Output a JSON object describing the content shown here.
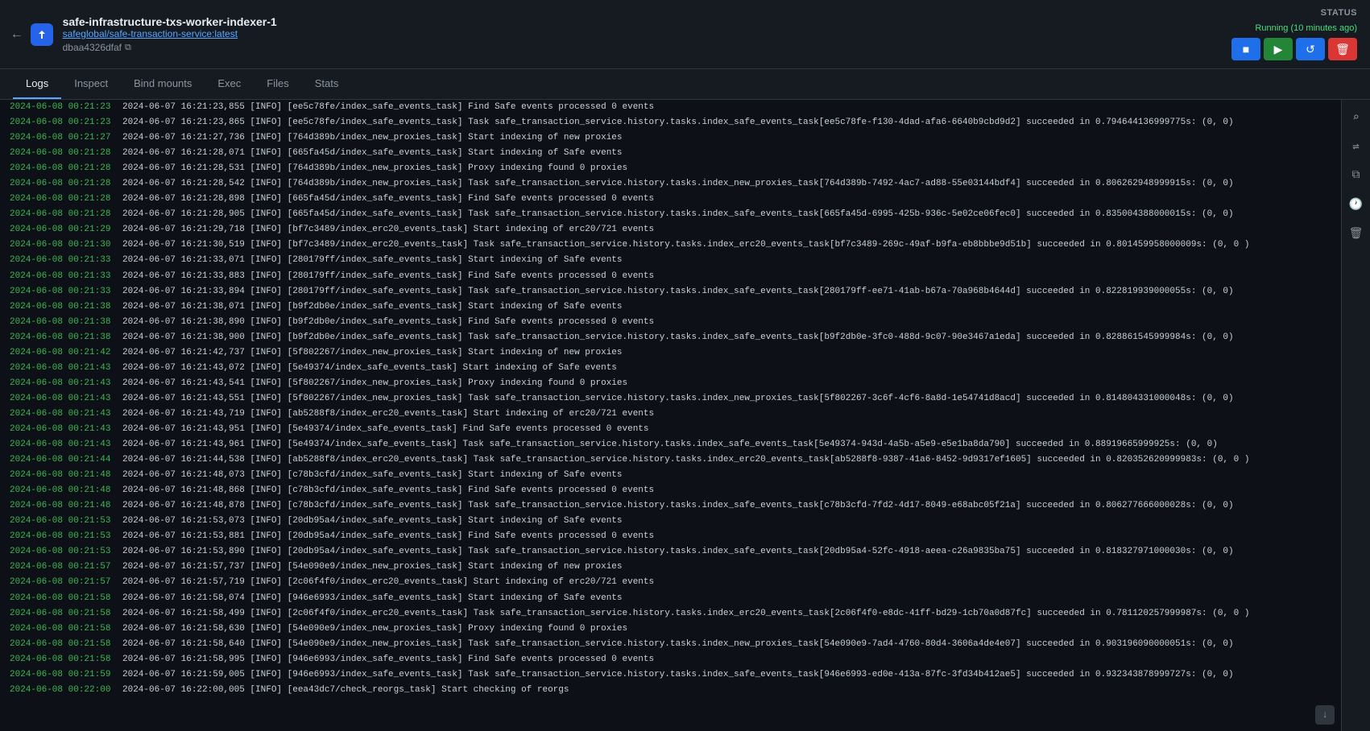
{
  "header": {
    "title": "safe-infrastructure-txs-worker-indexer-1",
    "subtitle": "safeglobal/safe-transaction-service:latest",
    "hash": "dbaa4326dfaf",
    "back_label": "←",
    "icon_text": "S",
    "copy_icon": "⧉"
  },
  "status": {
    "label": "STATUS",
    "text": "Running (10 minutes ago)",
    "buttons": {
      "stop_label": "■",
      "play_label": "▶",
      "restart_label": "↺",
      "delete_label": "🗑"
    }
  },
  "tabs": [
    {
      "id": "logs",
      "label": "Logs",
      "active": true
    },
    {
      "id": "inspect",
      "label": "Inspect",
      "active": false
    },
    {
      "id": "bind-mounts",
      "label": "Bind mounts",
      "active": false
    },
    {
      "id": "exec",
      "label": "Exec",
      "active": false
    },
    {
      "id": "files",
      "label": "Files",
      "active": false
    },
    {
      "id": "stats",
      "label": "Stats",
      "active": false
    }
  ],
  "sidebar_icons": [
    {
      "name": "search-icon",
      "symbol": "⌕"
    },
    {
      "name": "wrap-icon",
      "symbol": "⇌"
    },
    {
      "name": "copy-log-icon",
      "symbol": "⧉"
    },
    {
      "name": "clock-icon",
      "symbol": "🕐"
    },
    {
      "name": "trash-icon",
      "symbol": "🗑"
    }
  ],
  "logs": [
    {
      "ts": "2024-06-08 00:21:23",
      "line": "2024-06-07 16:21:23,855 [INFO] [ee5c78fe/index_safe_events_task] Find Safe events processed 0 events"
    },
    {
      "ts": "2024-06-08 00:21:23",
      "line": "2024-06-07 16:21:23,865 [INFO] [ee5c78fe/index_safe_events_task] Task safe_transaction_service.history.tasks.index_safe_events_task[ee5c78fe-f130-4dad-afa6-6640b9cbd9d2] succeeded in 0.794644136999775s: (0, 0)"
    },
    {
      "ts": "2024-06-08 00:21:27",
      "line": "2024-06-07 16:21:27,736 [INFO] [764d389b/index_new_proxies_task] Start indexing of new proxies"
    },
    {
      "ts": "2024-06-08 00:21:28",
      "line": "2024-06-07 16:21:28,071 [INFO] [665fa45d/index_safe_events_task] Start indexing of Safe events"
    },
    {
      "ts": "2024-06-08 00:21:28",
      "line": "2024-06-07 16:21:28,531 [INFO] [764d389b/index_new_proxies_task] Proxy indexing found 0 proxies"
    },
    {
      "ts": "2024-06-08 00:21:28",
      "line": "2024-06-07 16:21:28,542 [INFO] [764d389b/index_new_proxies_task] Task safe_transaction_service.history.tasks.index_new_proxies_task[764d389b-7492-4ac7-ad88-55e03144bdf4] succeeded in 0.806262948999915s: (0, 0)"
    },
    {
      "ts": "2024-06-08 00:21:28",
      "line": "2024-06-07 16:21:28,898 [INFO] [665fa45d/index_safe_events_task] Find Safe events processed 0 events"
    },
    {
      "ts": "2024-06-08 00:21:28",
      "line": "2024-06-07 16:21:28,905 [INFO] [665fa45d/index_safe_events_task] Task safe_transaction_service.history.tasks.index_safe_events_task[665fa45d-6995-425b-936c-5e02ce06fec0] succeeded in 0.835004388000015s: (0, 0)"
    },
    {
      "ts": "2024-06-08 00:21:29",
      "line": "2024-06-07 16:21:29,718 [INFO] [bf7c3489/index_erc20_events_task] Start indexing of erc20/721 events"
    },
    {
      "ts": "2024-06-08 00:21:30",
      "line": "2024-06-07 16:21:30,519 [INFO] [bf7c3489/index_erc20_events_task] Task safe_transaction_service.history.tasks.index_erc20_events_task[bf7c3489-269c-49af-b9fa-eb8bbbe9d51b] succeeded in 0.801459958000009s: (0, 0\n)"
    },
    {
      "ts": "2024-06-08 00:21:33",
      "line": "2024-06-07 16:21:33,071 [INFO] [280179ff/index_safe_events_task] Start indexing of Safe events"
    },
    {
      "ts": "2024-06-08 00:21:33",
      "line": "2024-06-07 16:21:33,883 [INFO] [280179ff/index_safe_events_task] Find Safe events processed 0 events"
    },
    {
      "ts": "2024-06-08 00:21:33",
      "line": "2024-06-07 16:21:33,894 [INFO] [280179ff/index_safe_events_task] Task safe_transaction_service.history.tasks.index_safe_events_task[280179ff-ee71-41ab-b67a-70a968b4644d] succeeded in 0.822819939000055s: (0, 0)"
    },
    {
      "ts": "2024-06-08 00:21:38",
      "line": "2024-06-07 16:21:38,071 [INFO] [b9f2db0e/index_safe_events_task] Start indexing of Safe events"
    },
    {
      "ts": "2024-06-08 00:21:38",
      "line": "2024-06-07 16:21:38,890 [INFO] [b9f2db0e/index_safe_events_task] Find Safe events processed 0 events"
    },
    {
      "ts": "2024-06-08 00:21:38",
      "line": "2024-06-07 16:21:38,900 [INFO] [b9f2db0e/index_safe_events_task] Task safe_transaction_service.history.tasks.index_safe_events_task[b9f2db0e-3fc0-488d-9c07-90e3467a1eda] succeeded in 0.828861545999984s: (0, 0)"
    },
    {
      "ts": "2024-06-08 00:21:42",
      "line": "2024-06-07 16:21:42,737 [INFO] [5f802267/index_new_proxies_task] Start indexing of new proxies"
    },
    {
      "ts": "2024-06-08 00:21:43",
      "line": "2024-06-07 16:21:43,072 [INFO] [5e49374/index_safe_events_task] Start indexing of Safe events"
    },
    {
      "ts": "2024-06-08 00:21:43",
      "line": "2024-06-07 16:21:43,541 [INFO] [5f802267/index_new_proxies_task] Proxy indexing found 0 proxies"
    },
    {
      "ts": "2024-06-08 00:21:43",
      "line": "2024-06-07 16:21:43,551 [INFO] [5f802267/index_new_proxies_task] Task safe_transaction_service.history.tasks.index_new_proxies_task[5f802267-3c6f-4cf6-8a8d-1e54741d8acd] succeeded in 0.814804331000048s: (0, 0)"
    },
    {
      "ts": "2024-06-08 00:21:43",
      "line": "2024-06-07 16:21:43,719 [INFO] [ab5288f8/index_erc20_events_task] Start indexing of erc20/721 events"
    },
    {
      "ts": "2024-06-08 00:21:43",
      "line": "2024-06-07 16:21:43,951 [INFO] [5e49374/index_safe_events_task] Find Safe events processed 0 events"
    },
    {
      "ts": "2024-06-08 00:21:43",
      "line": "2024-06-07 16:21:43,961 [INFO] [5e49374/index_safe_events_task] Task safe_transaction_service.history.tasks.index_safe_events_task[5e49374-943d-4a5b-a5e9-e5e1ba8da790] succeeded in 0.88919665999925s: (0, 0)"
    },
    {
      "ts": "2024-06-08 00:21:44",
      "line": "2024-06-07 16:21:44,538 [INFO] [ab5288f8/index_erc20_events_task] Task safe_transaction_service.history.tasks.index_erc20_events_task[ab5288f8-9387-41a6-8452-9d9317ef1605] succeeded in 0.820352620999983s: (0, 0\n)"
    },
    {
      "ts": "2024-06-08 00:21:48",
      "line": "2024-06-07 16:21:48,073 [INFO] [c78b3cfd/index_safe_events_task] Start indexing of Safe events"
    },
    {
      "ts": "2024-06-08 00:21:48",
      "line": "2024-06-07 16:21:48,868 [INFO] [c78b3cfd/index_safe_events_task] Find Safe events processed 0 events"
    },
    {
      "ts": "2024-06-08 00:21:48",
      "line": "2024-06-07 16:21:48,878 [INFO] [c78b3cfd/index_safe_events_task] Task safe_transaction_service.history.tasks.index_safe_events_task[c78b3cfd-7fd2-4d17-8049-e68abc05f21a] succeeded in 0.806277666000028s: (0, 0)"
    },
    {
      "ts": "2024-06-08 00:21:53",
      "line": "2024-06-07 16:21:53,073 [INFO] [20db95a4/index_safe_events_task] Start indexing of Safe events"
    },
    {
      "ts": "2024-06-08 00:21:53",
      "line": "2024-06-07 16:21:53,881 [INFO] [20db95a4/index_safe_events_task] Find Safe events processed 0 events"
    },
    {
      "ts": "2024-06-08 00:21:53",
      "line": "2024-06-07 16:21:53,890 [INFO] [20db95a4/index_safe_events_task] Task safe_transaction_service.history.tasks.index_safe_events_task[20db95a4-52fc-4918-aeea-c26a9835ba75] succeeded in 0.818327971000030s: (0, 0)"
    },
    {
      "ts": "2024-06-08 00:21:57",
      "line": "2024-06-07 16:21:57,737 [INFO] [54e090e9/index_new_proxies_task] Start indexing of new proxies"
    },
    {
      "ts": "2024-06-08 00:21:57",
      "line": "2024-06-07 16:21:57,719 [INFO] [2c06f4f0/index_erc20_events_task] Start indexing of erc20/721 events"
    },
    {
      "ts": "2024-06-08 00:21:58",
      "line": "2024-06-07 16:21:58,074 [INFO] [946e6993/index_safe_events_task] Start indexing of Safe events"
    },
    {
      "ts": "2024-06-08 00:21:58",
      "line": "2024-06-07 16:21:58,499 [INFO] [2c06f4f0/index_erc20_events_task] Task safe_transaction_service.history.tasks.index_erc20_events_task[2c06f4f0-e8dc-41ff-bd29-1cb70a0d87fc] succeeded in 0.781120257999987s: (0, 0\n)"
    },
    {
      "ts": "2024-06-08 00:21:58",
      "line": "2024-06-07 16:21:58,630 [INFO] [54e090e9/index_new_proxies_task] Proxy indexing found 0 proxies"
    },
    {
      "ts": "2024-06-08 00:21:58",
      "line": "2024-06-07 16:21:58,640 [INFO] [54e090e9/index_new_proxies_task] Task safe_transaction_service.history.tasks.index_new_proxies_task[54e090e9-7ad4-4760-80d4-3606a4de4e07] succeeded in 0.903196090000051s: (0, 0)"
    },
    {
      "ts": "2024-06-08 00:21:58",
      "line": "2024-06-07 16:21:58,995 [INFO] [946e6993/index_safe_events_task] Find Safe events processed 0 events"
    },
    {
      "ts": "2024-06-08 00:21:59",
      "line": "2024-06-07 16:21:59,005 [INFO] [946e6993/index_safe_events_task] Task safe_transaction_service.history.tasks.index_safe_events_task[946e6993-ed0e-413a-87fc-3fd34b412ae5] succeeded in 0.932343878999727s: (0, 0)"
    },
    {
      "ts": "2024-06-08 00:22:00",
      "line": "2024-06-07 16:22:00,005 [INFO] [eea43dc7/check_reorgs_task] Start checking of reorgs"
    }
  ]
}
